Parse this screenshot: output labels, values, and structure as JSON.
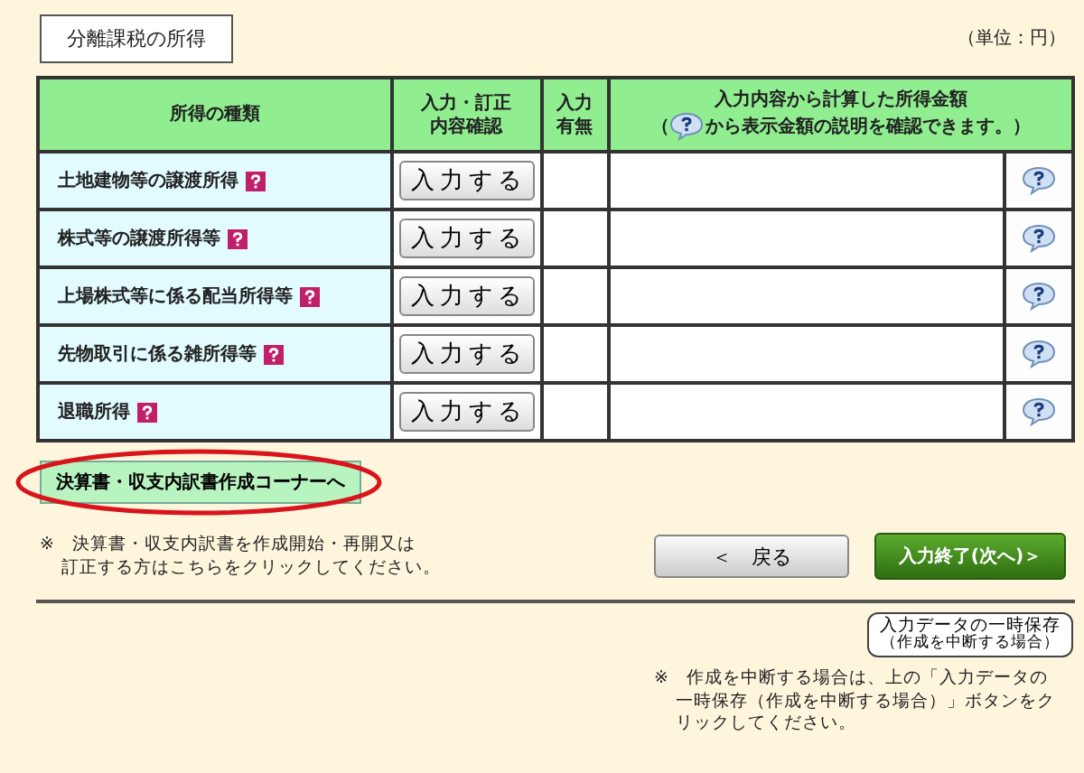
{
  "section_title": "分離課税の所得",
  "unit": "（単位：円）",
  "table": {
    "columns": [
      {
        "lines": [
          "所得の種類"
        ]
      },
      {
        "lines": [
          "入力・訂正",
          "内容確認"
        ]
      },
      {
        "lines": [
          "入力",
          "有無"
        ]
      },
      {
        "lines": [
          "入力内容から計算した所得金額"
        ],
        "note_before": "（",
        "note_after": "から表示金額の説明を確認できます。）"
      }
    ],
    "rows": [
      {
        "label": "土地建物等の譲渡所得",
        "button": "入力する"
      },
      {
        "label": "株式等の譲渡所得等",
        "button": "入力する"
      },
      {
        "label": "上場株式等に係る配当所得等",
        "button": "入力する"
      },
      {
        "label": "先物取引に係る雑所得等",
        "button": "入力する"
      },
      {
        "label": "退職所得",
        "button": "入力する"
      }
    ]
  },
  "corner_button": {
    "label": "決算書・収支内訳書作成コーナーへ",
    "highlighted": true
  },
  "corner_note": [
    "※　決算書・収支内訳書を作成開始・再開又は",
    "訂正する方はこちらをクリックしてください。"
  ],
  "back_button": "＜　戻る",
  "next_button": "入力終了(次へ)＞",
  "save_button": [
    "入力データの一時保存",
    "（作成を中断する場合）"
  ],
  "save_note": [
    "※　作成を中断する場合は、上の「入力データの",
    "一時保存（作成を中断する場合）」ボタンをク",
    "リックしてください。"
  ]
}
